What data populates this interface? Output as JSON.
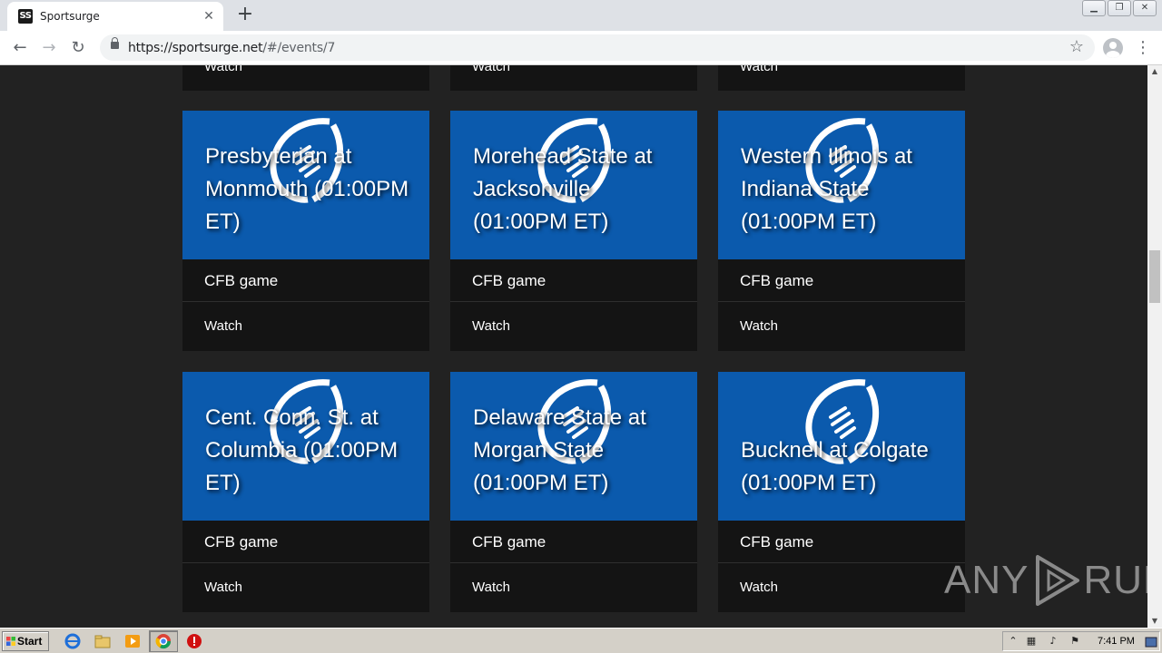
{
  "browser": {
    "tab_title": "Sportsurge",
    "favicon_text": "SS",
    "url_host": "https://sportsurge.net",
    "url_path": "/#/events/7",
    "close_glyph": "✕",
    "new_tab_glyph": "+",
    "back_glyph": "←",
    "forward_glyph": "→",
    "reload_glyph": "↻",
    "star_glyph": "☆",
    "menu_glyph": "⋮",
    "window_buttons": [
      "▁",
      "❐",
      "✕"
    ]
  },
  "partial_row": {
    "watch_label": "Watch"
  },
  "events": [
    {
      "title": "Presbyterian at Monmouth (01:00PM ET)",
      "category": "CFB game",
      "action": "Watch",
      "icon": "football-icon"
    },
    {
      "title": "Morehead State at Jacksonville (01:00PM ET)",
      "category": "CFB game",
      "action": "Watch",
      "icon": "football-icon"
    },
    {
      "title": "Western Illinois at Indiana State (01:00PM ET)",
      "category": "CFB game",
      "action": "Watch",
      "icon": "football-icon"
    },
    {
      "title": "Cent. Conn. St. at Columbia (01:00PM ET)",
      "category": "CFB game",
      "action": "Watch",
      "icon": "football-icon"
    },
    {
      "title": "Delaware State at Morgan State (01:00PM ET)",
      "category": "CFB game",
      "action": "Watch",
      "icon": "football-icon"
    },
    {
      "title": "Bucknell at Colgate (01:00PM ET)",
      "category": "CFB game",
      "action": "Watch",
      "icon": "football-icon"
    }
  ],
  "colors": {
    "card_blue": "#0b5aad",
    "card_dark": "#141414",
    "page_bg": "#222222"
  },
  "watermark": {
    "text_left": "ANY",
    "text_right": "RUN"
  },
  "taskbar": {
    "start_label": "Start",
    "clock": "7:41 PM"
  }
}
